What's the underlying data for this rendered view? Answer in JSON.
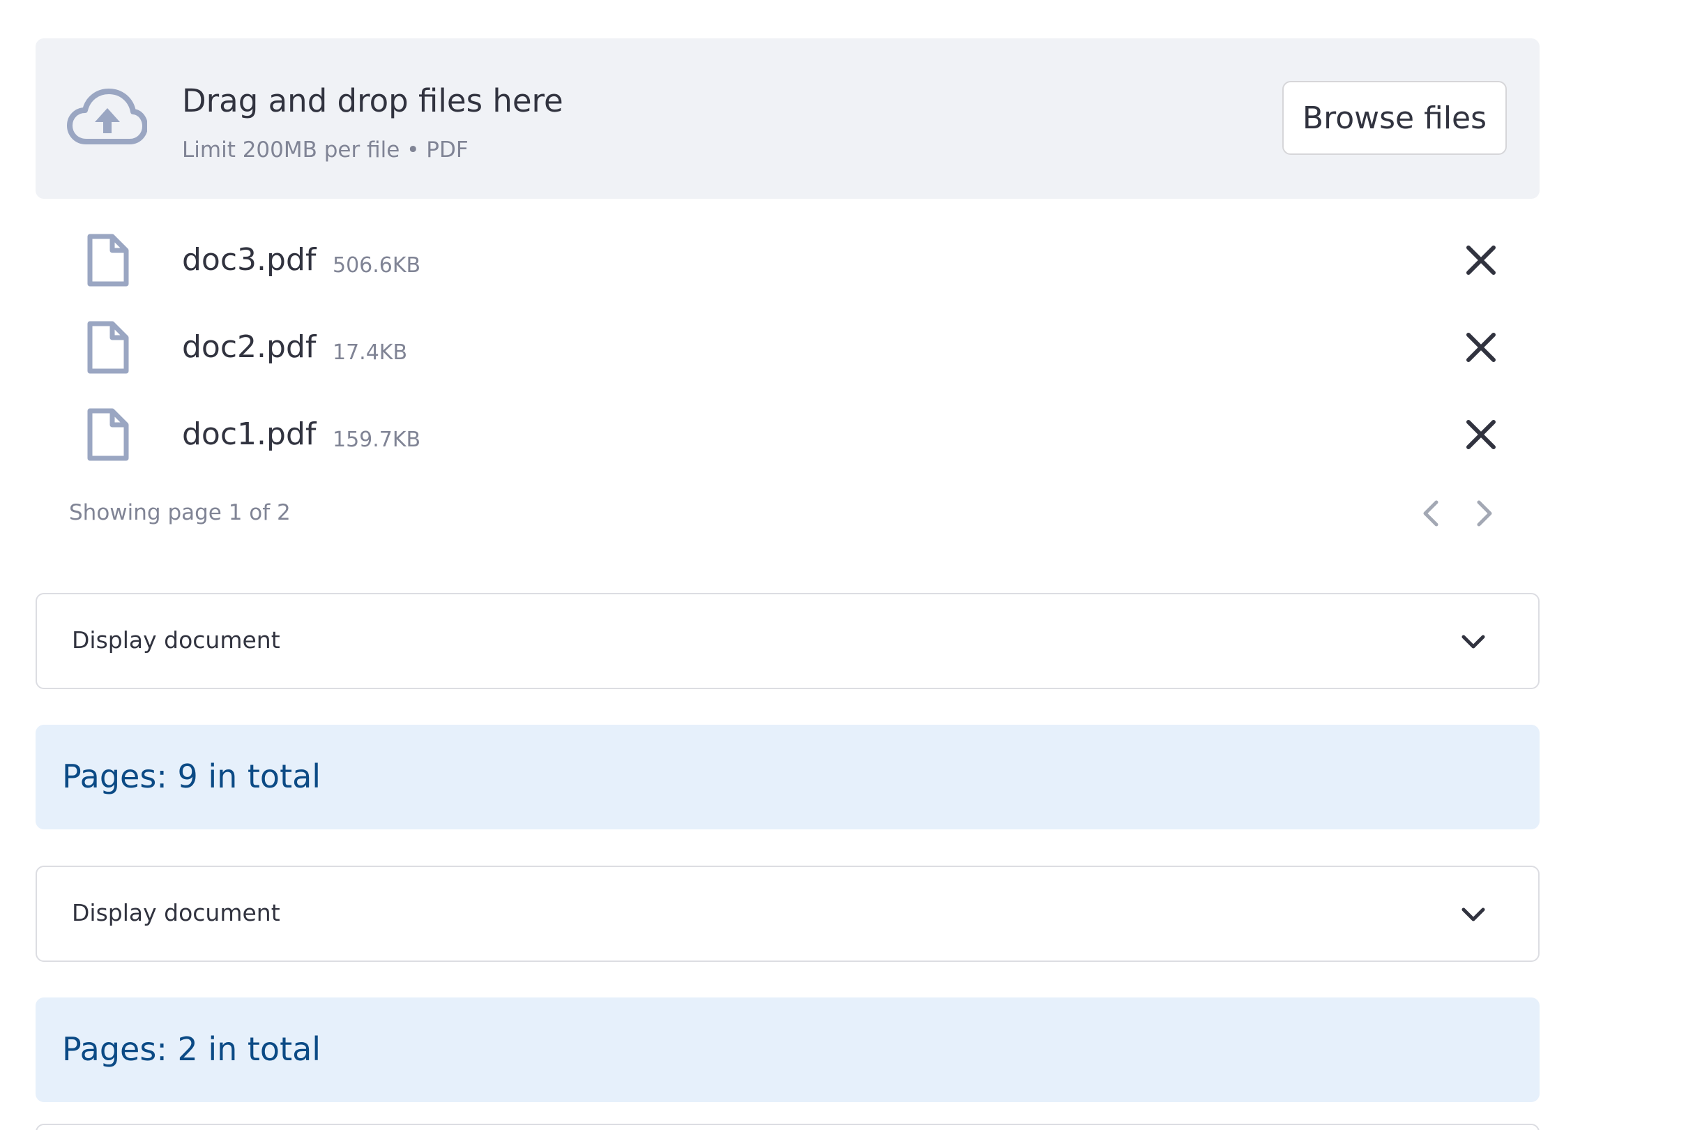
{
  "uploader": {
    "title": "Drag and drop files here",
    "limit": "Limit 200MB per file • PDF",
    "browse_label": "Browse files",
    "icon": "cloud-upload-icon"
  },
  "files": [
    {
      "name": "doc3.pdf",
      "size": "506.6KB"
    },
    {
      "name": "doc2.pdf",
      "size": "17.4KB"
    },
    {
      "name": "doc1.pdf",
      "size": "159.7KB"
    }
  ],
  "pagination": {
    "text": "Showing page 1 of 2",
    "current_page": 1,
    "total_pages": 2
  },
  "sections": [
    {
      "expander_label": "Display document",
      "info": "Pages: 9 in total"
    },
    {
      "expander_label": "Display document",
      "info": "Pages: 2 in total"
    }
  ],
  "colors": {
    "dropzone_bg": "#f0f2f6",
    "info_bg": "#e6f0fb",
    "info_text": "#0b4a85",
    "muted_text": "#808495",
    "icon_gray": "#9aa6c2"
  }
}
